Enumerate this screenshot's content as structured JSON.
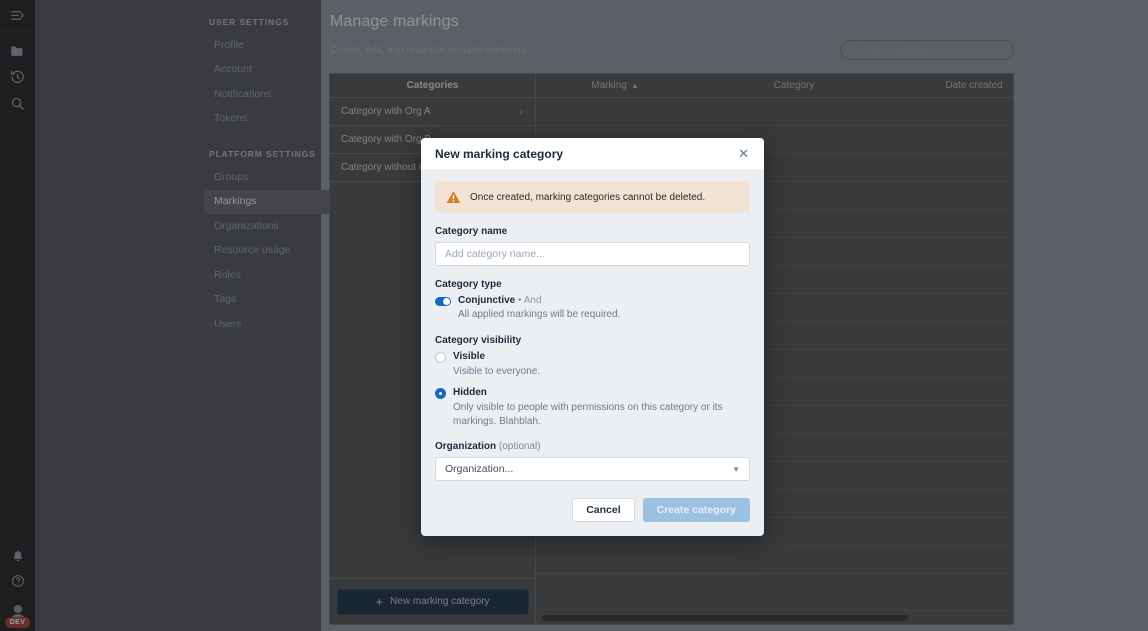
{
  "rail": {
    "toggle_icon": "expand-sidebar-icon",
    "icons": [
      "folder-icon",
      "history-icon",
      "search-icon"
    ],
    "bottom_icons": [
      "bell-icon",
      "help-icon"
    ],
    "avatar_badge": "DEV"
  },
  "sidebar": {
    "sections": [
      {
        "heading": "User settings",
        "items": [
          {
            "label": "Profile",
            "active": false
          },
          {
            "label": "Account",
            "active": false
          },
          {
            "label": "Notifications",
            "active": false
          },
          {
            "label": "Tokens",
            "active": false
          }
        ]
      },
      {
        "heading": "Platform settings",
        "items": [
          {
            "label": "Groups",
            "active": false
          },
          {
            "label": "Markings",
            "active": true
          },
          {
            "label": "Organizations",
            "active": false
          },
          {
            "label": "Resource usage",
            "active": false
          },
          {
            "label": "Roles",
            "active": false
          },
          {
            "label": "Tags",
            "active": false
          },
          {
            "label": "Users",
            "active": false
          }
        ]
      }
    ]
  },
  "page": {
    "title": "Manage markings",
    "subtitle": "Create, edit, and organize security markings.",
    "filter_placeholder": "Filter markings..."
  },
  "table": {
    "categories_header": "Categories",
    "category_rows": [
      {
        "label": "Category with Org A"
      },
      {
        "label": "Category with Org B"
      },
      {
        "label": "Category without org"
      }
    ],
    "chevron": "›",
    "marking_headers": [
      {
        "label": "Marking",
        "sorted": true,
        "caret": "▲"
      },
      {
        "label": "Category",
        "sorted": false,
        "caret": ""
      },
      {
        "label": "Date created",
        "sorted": false,
        "caret": ""
      }
    ],
    "new_category_button": "New marking category",
    "new_category_plus": "+"
  },
  "modal": {
    "title": "New marking category",
    "close_icon": "✕",
    "alert": "Once created, marking categories cannot be deleted.",
    "category_name": {
      "label": "Category name",
      "placeholder": "Add category name...",
      "value": ""
    },
    "category_type": {
      "label": "Category type",
      "toggle_label": "Conjunctive",
      "toggle_suffix": "• And",
      "enabled": true,
      "helper": "All applied markings will be required."
    },
    "category_visibility": {
      "label": "Category visibility",
      "options": [
        {
          "label": "Visible",
          "helper": "Visible to everyone.",
          "selected": false
        },
        {
          "label": "Hidden",
          "helper": "Only visible to people with permissions on this category or its markings. Blahblah.",
          "selected": true
        }
      ]
    },
    "organization": {
      "label": "Organization",
      "optional": "(optional)",
      "value": "Organization...",
      "caret": "▼"
    },
    "cancel_label": "Cancel",
    "create_label": "Create category"
  },
  "colors": {
    "accent_blue": "#1668c1",
    "alert_bg": "#f2e3d5",
    "warning_orange": "#d87d2b",
    "dev_badge_red": "#e03c31",
    "primary_disabled": "#9cc0e0"
  }
}
